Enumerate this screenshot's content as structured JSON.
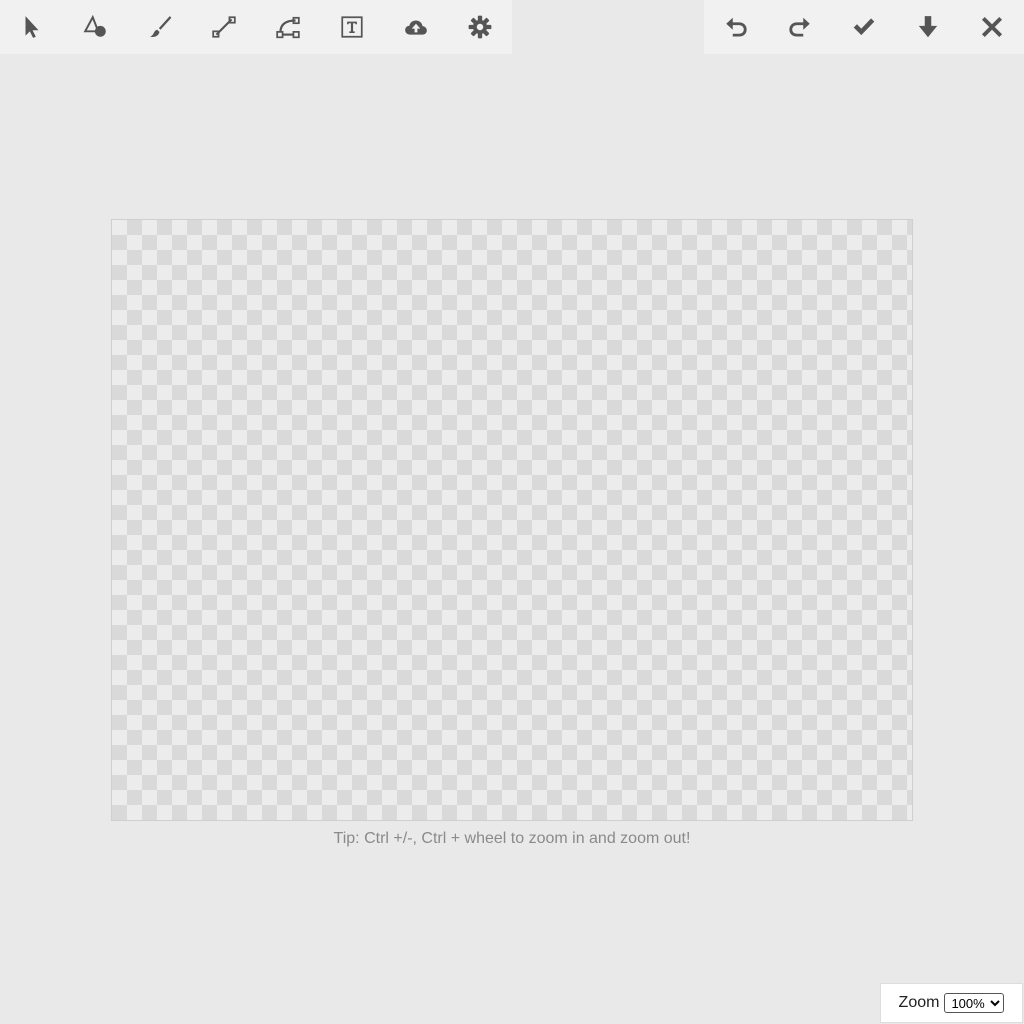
{
  "toolbar": {
    "left_tools": [
      {
        "name": "select-tool-button",
        "icon": "pointer-icon"
      },
      {
        "name": "shapes-tool-button",
        "icon": "shapes-icon"
      },
      {
        "name": "brush-tool-button",
        "icon": "brush-icon"
      },
      {
        "name": "line-tool-button",
        "icon": "line-icon"
      },
      {
        "name": "curve-tool-button",
        "icon": "bezier-curve-icon"
      },
      {
        "name": "text-tool-button",
        "icon": "text-icon"
      },
      {
        "name": "upload-button",
        "icon": "cloud-upload-icon"
      },
      {
        "name": "settings-button",
        "icon": "gear-icon"
      }
    ],
    "right_tools": [
      {
        "name": "undo-button",
        "icon": "undo-icon"
      },
      {
        "name": "redo-button",
        "icon": "redo-icon"
      },
      {
        "name": "apply-button",
        "icon": "checkmark-icon"
      },
      {
        "name": "download-button",
        "icon": "download-arrow-icon"
      },
      {
        "name": "close-button",
        "icon": "close-icon"
      }
    ]
  },
  "canvas": {
    "tip": "Tip: Ctrl +/-, Ctrl + wheel to zoom in and zoom out!"
  },
  "zoom": {
    "label": "Zoom",
    "selected": "100%"
  },
  "colors": {
    "background": "#e9e9e9",
    "toolbar": "#f1f1f1",
    "icon": "#555555",
    "tip_text": "#8a8a8a"
  }
}
